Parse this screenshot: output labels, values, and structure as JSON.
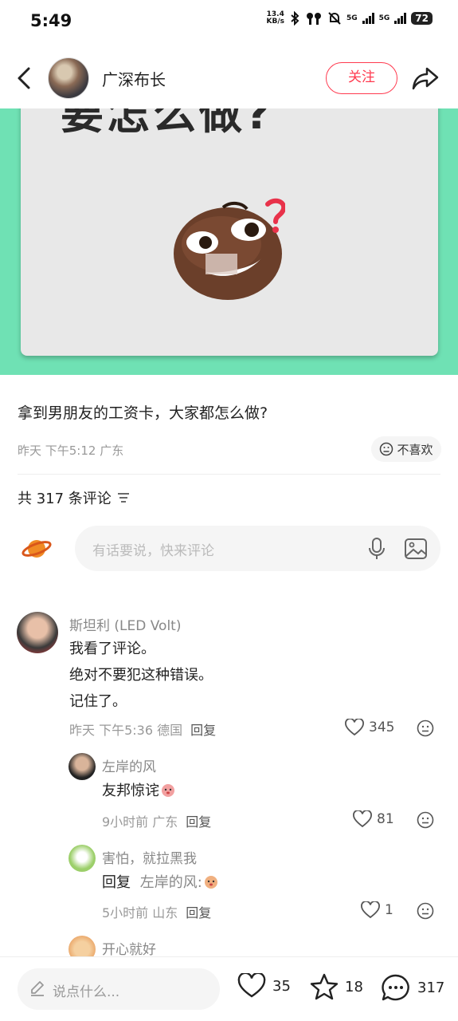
{
  "status_bar": {
    "time": "5:49",
    "net_speed_value": "13.4",
    "net_speed_unit": "KB/s",
    "signal1": "5G",
    "signal2": "5G",
    "battery": "72"
  },
  "header": {
    "author_name": "广深布长",
    "follow_label": "关注"
  },
  "hero": {
    "overlay_text": "要怎么做?"
  },
  "post": {
    "title": "拿到男朋友的工资卡，大家都怎么做?",
    "meta": "昨天 下午5:12 广东",
    "dislike_label": "不喜欢"
  },
  "comments_header": {
    "count_label": "共 317 条评论"
  },
  "comment_input": {
    "placeholder": "有话要说，快来评论"
  },
  "comments": [
    {
      "name": "斯坦利 (LED Volt)",
      "lines": [
        "我看了评论。",
        "绝对不要犯这种错误。",
        "记住了。"
      ],
      "time": "昨天 下午5:36 德国",
      "reply_label": "回复",
      "likes": "345"
    },
    {
      "name": "左岸的风",
      "text": "友邦惊诧",
      "time": "9小时前 广东",
      "reply_label": "回复",
      "likes": "81"
    },
    {
      "name": "害怕，就拉黑我",
      "reply_prefix": "回复",
      "reply_target": "左岸的风:",
      "time": "5小时前 山东",
      "reply_label": "回复",
      "likes": "1"
    },
    {
      "name": "开心就好"
    }
  ],
  "bottom_bar": {
    "say_placeholder": "说点什么...",
    "likes": "35",
    "favorites": "18",
    "comments": "317"
  },
  "colors": {
    "accent": "#ff3a4f",
    "hero_bg": "#6fe1b4"
  }
}
